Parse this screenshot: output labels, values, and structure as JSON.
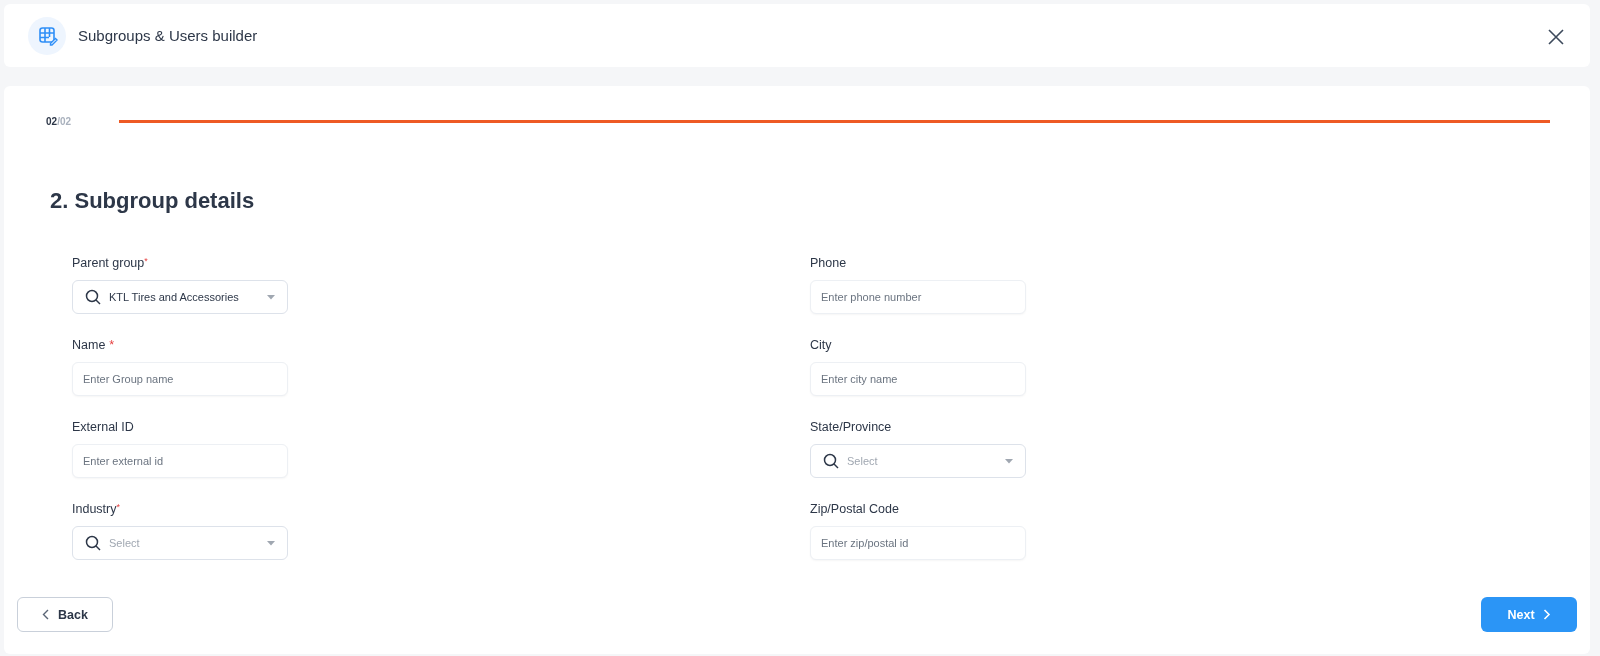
{
  "header": {
    "title": "Subgroups & Users builder"
  },
  "progress": {
    "current": "02",
    "separator": "/",
    "total": "02",
    "level": 1
  },
  "section_title": "2. Subgroup details",
  "columns": [
    [
      {
        "label": "Parent group",
        "required_mark": {
          "text": "*",
          "kind": "raised"
        },
        "kind": "select",
        "value": "KTL Tires and Accessories"
      },
      {
        "label": "Name",
        "required_mark": {
          "text": "*",
          "kind": "inline"
        },
        "kind": "text",
        "placeholder": "Enter Group name"
      },
      {
        "label": "External ID",
        "kind": "text",
        "placeholder": "Enter external id"
      },
      {
        "label": "Industry",
        "required_mark": {
          "text": "*",
          "kind": "raised"
        },
        "kind": "select",
        "placeholder": "Select"
      }
    ],
    [
      {
        "label": "Phone",
        "kind": "text",
        "placeholder": "Enter phone number"
      },
      {
        "label": "City",
        "kind": "text",
        "placeholder": "Enter city name"
      },
      {
        "label": "State/Province",
        "kind": "select",
        "placeholder": "Select"
      },
      {
        "label": "Zip/Postal Code",
        "kind": "text",
        "placeholder": "Enter zip/postal id"
      }
    ]
  ],
  "buttons": {
    "back": "Back",
    "next": "Next"
  }
}
